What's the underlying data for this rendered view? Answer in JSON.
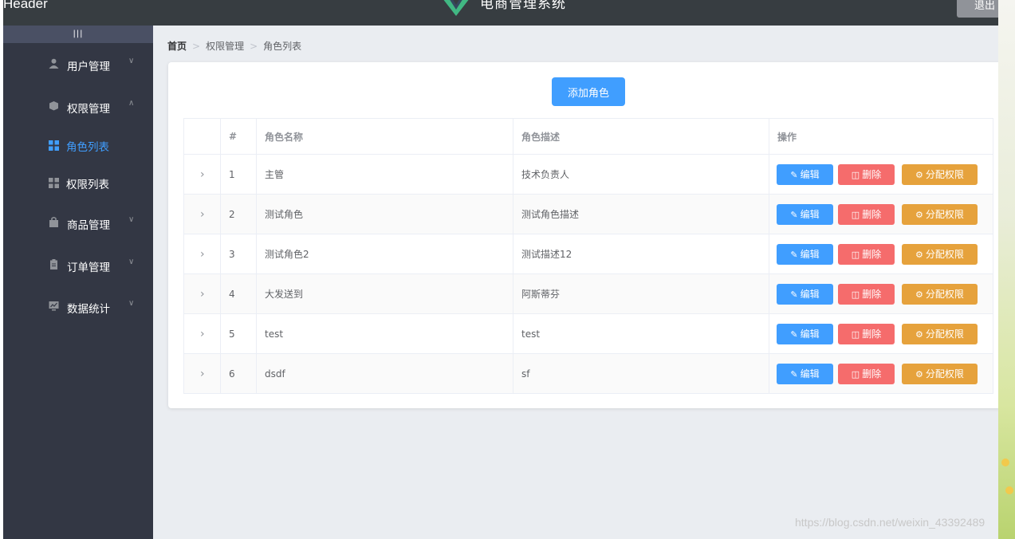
{
  "header": {
    "corner_text": "Header",
    "title": "电商管理系统",
    "logout_label": "退出"
  },
  "aside": {
    "toggle_label": "|||",
    "menus": [
      {
        "label": "用户管理",
        "icon": "user-icon",
        "expanded": false
      },
      {
        "label": "权限管理",
        "icon": "box-icon",
        "expanded": true
      },
      {
        "label": "商品管理",
        "icon": "bag-icon",
        "expanded": false
      },
      {
        "label": "订单管理",
        "icon": "clipboard-icon",
        "expanded": false
      },
      {
        "label": "数据统计",
        "icon": "chart-icon",
        "expanded": false
      }
    ],
    "submenus": [
      {
        "label": "角色列表",
        "icon": "grid-icon",
        "active": true
      },
      {
        "label": "权限列表",
        "icon": "grid-icon",
        "active": false
      }
    ],
    "active_color": "#409eff",
    "background_color": "#333744"
  },
  "breadcrumb": [
    "首页",
    "权限管理",
    "角色列表"
  ],
  "card": {
    "add_button_label": "添加角色"
  },
  "table": {
    "headers": [
      "",
      "#",
      "角色名称",
      "角色描述",
      "操作"
    ],
    "rows": [
      {
        "index": "1",
        "name": "主管",
        "desc": "技术负责人"
      },
      {
        "index": "2",
        "name": "测试角色",
        "desc": "测试角色描述"
      },
      {
        "index": "3",
        "name": "测试角色2",
        "desc": "测试描述12"
      },
      {
        "index": "4",
        "name": "大发送到",
        "desc": "阿斯蒂芬"
      },
      {
        "index": "5",
        "name": "test",
        "desc": "test"
      },
      {
        "index": "6",
        "name": "dsdf",
        "desc": "sf"
      }
    ],
    "actions": {
      "edit": "编辑",
      "delete": "删除",
      "assign": "分配权限"
    },
    "action_colors": {
      "edit": "#409eff",
      "delete": "#f56c6c",
      "assign": "#e6a23c"
    }
  },
  "watermark": "https://blog.csdn.net/weixin_43392489"
}
